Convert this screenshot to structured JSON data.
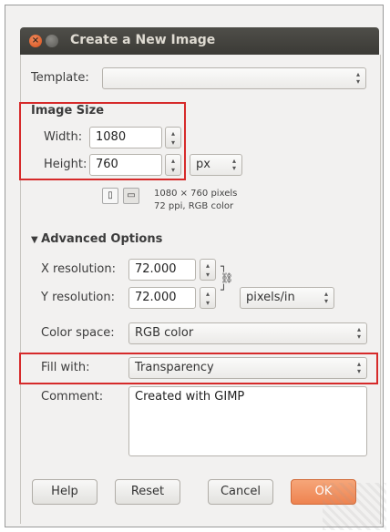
{
  "window": {
    "title": "Create a New Image"
  },
  "template": {
    "label": "Template:",
    "value": ""
  },
  "image_size": {
    "heading": "Image Size",
    "width_label": "Width:",
    "width_value": "1080",
    "height_label": "Height:",
    "height_value": "760",
    "unit": "px",
    "info_line1": "1080 × 760 pixels",
    "info_line2": "72 ppi, RGB color"
  },
  "advanced": {
    "heading": "Advanced Options",
    "xres_label": "X resolution:",
    "xres_value": "72.000",
    "yres_label": "Y resolution:",
    "yres_value": "72.000",
    "res_unit": "pixels/in",
    "colorspace_label": "Color space:",
    "colorspace_value": "RGB color",
    "fill_label": "Fill with:",
    "fill_value": "Transparency",
    "comment_label": "Comment:",
    "comment_value": "Created with GIMP"
  },
  "buttons": {
    "help": "Help",
    "reset": "Reset",
    "cancel": "Cancel",
    "ok": "OK"
  },
  "icons": {
    "close": "close-icon",
    "minimize": "minimize-icon",
    "portrait": "portrait-icon",
    "landscape": "landscape-icon",
    "chain": "chain-link-icon",
    "expander": "triangle-down-icon"
  },
  "colors": {
    "highlight": "#d62a2a",
    "ok_button": "#ee8350",
    "titlebar": "#3b3a36"
  }
}
